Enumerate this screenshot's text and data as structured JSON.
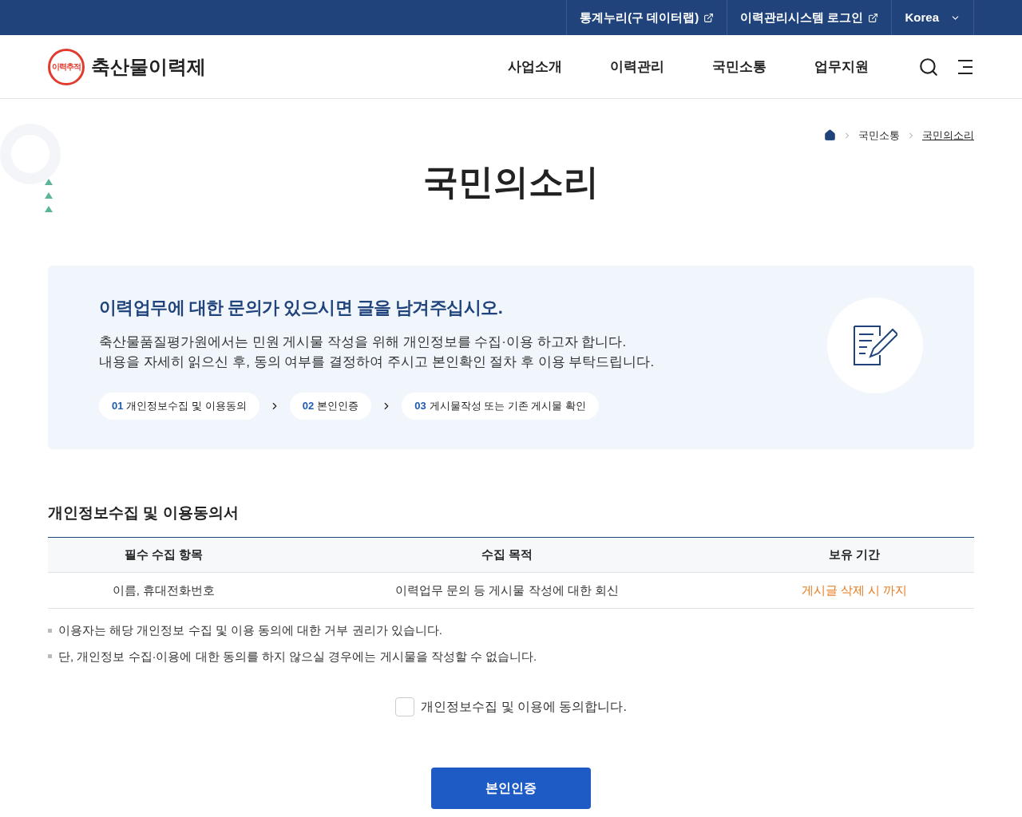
{
  "top_bar": {
    "links": [
      {
        "label": "통계누리(구 데이터랩)",
        "kind": "external"
      },
      {
        "label": "이력관리시스템 로그인",
        "kind": "external"
      },
      {
        "label": "Korea",
        "kind": "dropdown"
      }
    ]
  },
  "header": {
    "logo_badge": "이력추적",
    "logo_text": "축산물이력제",
    "nav": [
      "사업소개",
      "이력관리",
      "국민소통",
      "업무지원"
    ]
  },
  "breadcrumb": [
    "국민소통",
    "국민의소리"
  ],
  "page_title": "국민의소리",
  "intro": {
    "heading": "이력업무에 대한 문의가 있으시면 글을 남겨주십시오.",
    "lines": [
      "축산물품질평가원에서는 민원 게시물 작성을 위해 개인정보를 수집·이용 하고자 합니다.",
      "내용을 자세히 읽으신 후, 동의 여부를 결정하여 주시고 본인확인 절차 후 이용 부탁드립니다."
    ],
    "steps": [
      {
        "number": "01",
        "label": "개인정보수집 및 이용동의"
      },
      {
        "number": "02",
        "label": "본인인증"
      },
      {
        "number": "03",
        "label": "게시물작성 또는 기존 게시물 확인"
      }
    ]
  },
  "consent": {
    "title": "개인정보수집 및 이용동의서",
    "table": {
      "columns": [
        "필수 수집 항목",
        "수집 목적",
        "보유 기간"
      ],
      "rows": [
        [
          "이름, 휴대전화번호",
          "이력업무 문의 등 게시물 작성에 대한 회신",
          "게시글 삭제 시 까지"
        ]
      ]
    },
    "notes": [
      "이용자는 해당 개인정보 수집 및 이용 동의에 대한 거부 권리가 있습니다.",
      "단, 개인정보 수집·이용에 대한 동의를 하지 않으실 경우에는 게시물을 작성할 수 없습니다."
    ],
    "agree": {
      "label": "개인정보수집 및 이용에 동의합니다.",
      "checked": false
    },
    "button": "본인인증"
  }
}
